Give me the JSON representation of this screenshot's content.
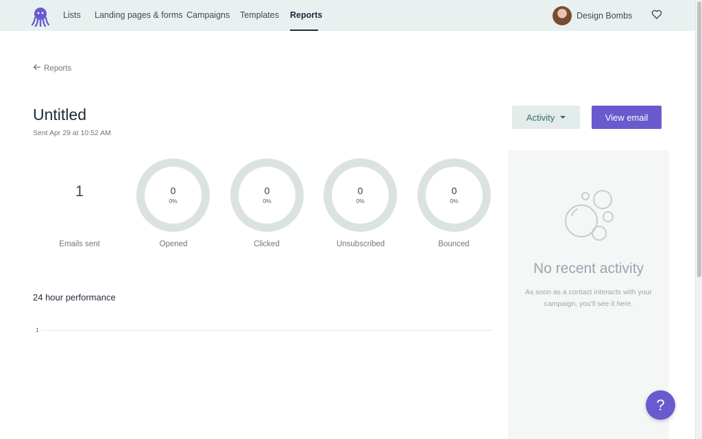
{
  "nav": {
    "items": [
      {
        "label": "Lists",
        "active": false
      },
      {
        "label": "Landing pages & forms",
        "active": false
      },
      {
        "label": "Campaigns",
        "active": false
      },
      {
        "label": "Templates",
        "active": false
      },
      {
        "label": "Reports",
        "active": true
      }
    ],
    "user_name": "Design Bombs"
  },
  "breadcrumb": {
    "label": "Reports"
  },
  "campaign": {
    "title": "Untitled",
    "sent_info": "Sent Apr 29 at 10:52 AM"
  },
  "actions": {
    "activity_label": "Activity",
    "view_email_label": "View email"
  },
  "stats": {
    "emails_sent": {
      "value": "1",
      "label": "Emails sent"
    },
    "opened": {
      "value": "0",
      "pct": "0%",
      "label": "Opened"
    },
    "clicked": {
      "value": "0",
      "pct": "0%",
      "label": "Clicked"
    },
    "unsubscribed": {
      "value": "0",
      "pct": "0%",
      "label": "Unsubscribed"
    },
    "bounced": {
      "value": "0",
      "pct": "0%",
      "label": "Bounced"
    }
  },
  "performance": {
    "title": "24 hour performance"
  },
  "chart_data": {
    "type": "line",
    "title": "24 hour performance",
    "yticks": [
      "1"
    ],
    "series": []
  },
  "activity_panel": {
    "title": "No recent activity",
    "text": "As soon as a contact interacts with your campaign, you'll see it here."
  },
  "help": {
    "label": "?"
  },
  "colors": {
    "accent": "#6a5acd",
    "nav_bg": "#e8f1ef",
    "ring": "#dbe3e1"
  },
  "icons": [
    "octopus-logo-icon",
    "arrow-left-icon",
    "heart-icon",
    "bubbles-icon",
    "caret-down-icon"
  ]
}
